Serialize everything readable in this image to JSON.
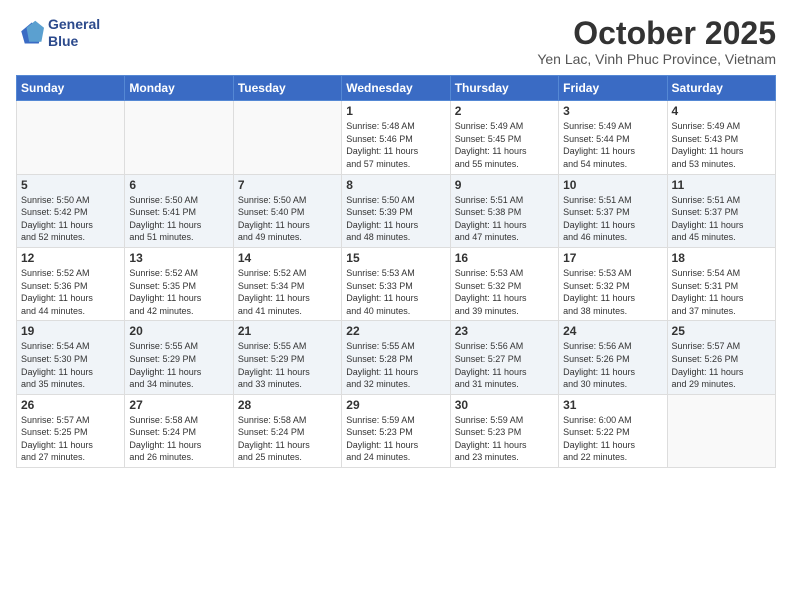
{
  "logo": {
    "line1": "General",
    "line2": "Blue"
  },
  "title": "October 2025",
  "subtitle": "Yen Lac, Vinh Phuc Province, Vietnam",
  "days_of_week": [
    "Sunday",
    "Monday",
    "Tuesday",
    "Wednesday",
    "Thursday",
    "Friday",
    "Saturday"
  ],
  "weeks": [
    [
      {
        "day": "",
        "info": ""
      },
      {
        "day": "",
        "info": ""
      },
      {
        "day": "",
        "info": ""
      },
      {
        "day": "1",
        "info": "Sunrise: 5:48 AM\nSunset: 5:46 PM\nDaylight: 11 hours\nand 57 minutes."
      },
      {
        "day": "2",
        "info": "Sunrise: 5:49 AM\nSunset: 5:45 PM\nDaylight: 11 hours\nand 55 minutes."
      },
      {
        "day": "3",
        "info": "Sunrise: 5:49 AM\nSunset: 5:44 PM\nDaylight: 11 hours\nand 54 minutes."
      },
      {
        "day": "4",
        "info": "Sunrise: 5:49 AM\nSunset: 5:43 PM\nDaylight: 11 hours\nand 53 minutes."
      }
    ],
    [
      {
        "day": "5",
        "info": "Sunrise: 5:50 AM\nSunset: 5:42 PM\nDaylight: 11 hours\nand 52 minutes."
      },
      {
        "day": "6",
        "info": "Sunrise: 5:50 AM\nSunset: 5:41 PM\nDaylight: 11 hours\nand 51 minutes."
      },
      {
        "day": "7",
        "info": "Sunrise: 5:50 AM\nSunset: 5:40 PM\nDaylight: 11 hours\nand 49 minutes."
      },
      {
        "day": "8",
        "info": "Sunrise: 5:50 AM\nSunset: 5:39 PM\nDaylight: 11 hours\nand 48 minutes."
      },
      {
        "day": "9",
        "info": "Sunrise: 5:51 AM\nSunset: 5:38 PM\nDaylight: 11 hours\nand 47 minutes."
      },
      {
        "day": "10",
        "info": "Sunrise: 5:51 AM\nSunset: 5:37 PM\nDaylight: 11 hours\nand 46 minutes."
      },
      {
        "day": "11",
        "info": "Sunrise: 5:51 AM\nSunset: 5:37 PM\nDaylight: 11 hours\nand 45 minutes."
      }
    ],
    [
      {
        "day": "12",
        "info": "Sunrise: 5:52 AM\nSunset: 5:36 PM\nDaylight: 11 hours\nand 44 minutes."
      },
      {
        "day": "13",
        "info": "Sunrise: 5:52 AM\nSunset: 5:35 PM\nDaylight: 11 hours\nand 42 minutes."
      },
      {
        "day": "14",
        "info": "Sunrise: 5:52 AM\nSunset: 5:34 PM\nDaylight: 11 hours\nand 41 minutes."
      },
      {
        "day": "15",
        "info": "Sunrise: 5:53 AM\nSunset: 5:33 PM\nDaylight: 11 hours\nand 40 minutes."
      },
      {
        "day": "16",
        "info": "Sunrise: 5:53 AM\nSunset: 5:32 PM\nDaylight: 11 hours\nand 39 minutes."
      },
      {
        "day": "17",
        "info": "Sunrise: 5:53 AM\nSunset: 5:32 PM\nDaylight: 11 hours\nand 38 minutes."
      },
      {
        "day": "18",
        "info": "Sunrise: 5:54 AM\nSunset: 5:31 PM\nDaylight: 11 hours\nand 37 minutes."
      }
    ],
    [
      {
        "day": "19",
        "info": "Sunrise: 5:54 AM\nSunset: 5:30 PM\nDaylight: 11 hours\nand 35 minutes."
      },
      {
        "day": "20",
        "info": "Sunrise: 5:55 AM\nSunset: 5:29 PM\nDaylight: 11 hours\nand 34 minutes."
      },
      {
        "day": "21",
        "info": "Sunrise: 5:55 AM\nSunset: 5:29 PM\nDaylight: 11 hours\nand 33 minutes."
      },
      {
        "day": "22",
        "info": "Sunrise: 5:55 AM\nSunset: 5:28 PM\nDaylight: 11 hours\nand 32 minutes."
      },
      {
        "day": "23",
        "info": "Sunrise: 5:56 AM\nSunset: 5:27 PM\nDaylight: 11 hours\nand 31 minutes."
      },
      {
        "day": "24",
        "info": "Sunrise: 5:56 AM\nSunset: 5:26 PM\nDaylight: 11 hours\nand 30 minutes."
      },
      {
        "day": "25",
        "info": "Sunrise: 5:57 AM\nSunset: 5:26 PM\nDaylight: 11 hours\nand 29 minutes."
      }
    ],
    [
      {
        "day": "26",
        "info": "Sunrise: 5:57 AM\nSunset: 5:25 PM\nDaylight: 11 hours\nand 27 minutes."
      },
      {
        "day": "27",
        "info": "Sunrise: 5:58 AM\nSunset: 5:24 PM\nDaylight: 11 hours\nand 26 minutes."
      },
      {
        "day": "28",
        "info": "Sunrise: 5:58 AM\nSunset: 5:24 PM\nDaylight: 11 hours\nand 25 minutes."
      },
      {
        "day": "29",
        "info": "Sunrise: 5:59 AM\nSunset: 5:23 PM\nDaylight: 11 hours\nand 24 minutes."
      },
      {
        "day": "30",
        "info": "Sunrise: 5:59 AM\nSunset: 5:23 PM\nDaylight: 11 hours\nand 23 minutes."
      },
      {
        "day": "31",
        "info": "Sunrise: 6:00 AM\nSunset: 5:22 PM\nDaylight: 11 hours\nand 22 minutes."
      },
      {
        "day": "",
        "info": ""
      }
    ]
  ]
}
